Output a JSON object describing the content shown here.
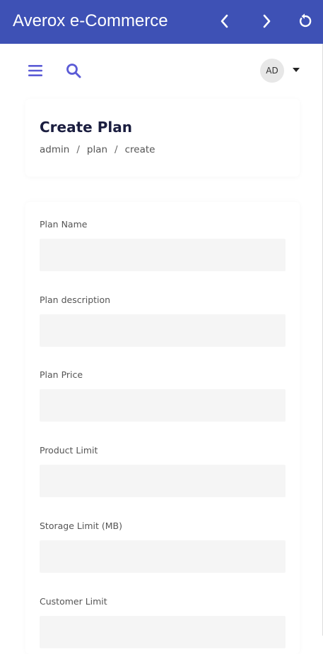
{
  "app_bar": {
    "title": "Averox e-Commerce",
    "background_color": "#3e51b5",
    "back_icon": "chevron-left-icon",
    "forward_icon": "chevron-right-icon",
    "refresh_icon": "refresh-icon"
  },
  "topbar": {
    "menu_icon": "hamburger-menu-icon",
    "search_icon": "search-icon",
    "avatar_initials": "AD",
    "caret_icon": "caret-down-icon",
    "accent_color": "#5b5bd6"
  },
  "header": {
    "title": "Create Plan",
    "breadcrumb": [
      "admin",
      "plan",
      "create"
    ],
    "separator": "/"
  },
  "form": {
    "fields": [
      {
        "label": "Plan Name",
        "value": ""
      },
      {
        "label": "Plan description",
        "value": ""
      },
      {
        "label": "Plan Price",
        "value": ""
      },
      {
        "label": "Product Limit",
        "value": ""
      },
      {
        "label": "Storage Limit (MB)",
        "value": ""
      },
      {
        "label": "Customer Limit",
        "value": ""
      }
    ]
  }
}
